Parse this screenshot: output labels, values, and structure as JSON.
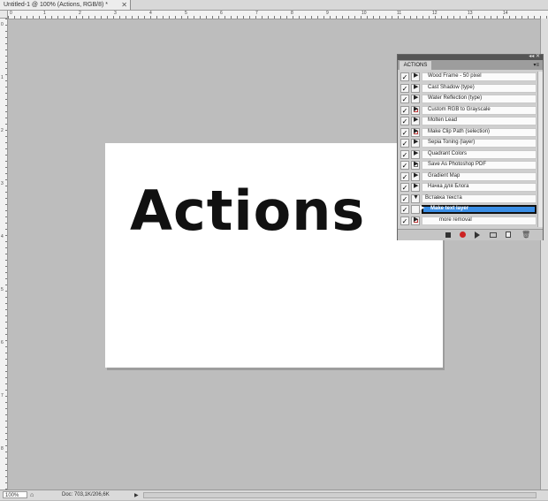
{
  "document": {
    "tab_title": "Untitled-1 @ 100% (Actions, RGB/8)",
    "tab_modified": "*",
    "canvas_text": "Actions"
  },
  "rulers": {
    "top": [
      "0",
      "1",
      "2",
      "3",
      "4",
      "5",
      "6",
      "7",
      "8",
      "9",
      "10",
      "11",
      "12",
      "13",
      "14"
    ],
    "left": [
      "0",
      "1",
      "2",
      "3",
      "4",
      "5",
      "6",
      "7",
      "8"
    ]
  },
  "statusbar": {
    "zoom": "100%",
    "doc_size": "Doc: 703,1K/206,6K"
  },
  "actions_panel": {
    "tab_label": "ACTIONS",
    "menu_icon": "panel-menu-icon",
    "items": [
      {
        "label": "Wood Frame - 50 pixel",
        "checked": true,
        "dialog": false,
        "expanded": false
      },
      {
        "label": "Cast Shadow (type)",
        "checked": true,
        "dialog": false,
        "expanded": false
      },
      {
        "label": "Water Reflection (type)",
        "checked": true,
        "dialog": false,
        "expanded": false
      },
      {
        "label": "Custom RGB to Grayscale",
        "checked": true,
        "dialog": true,
        "expanded": false
      },
      {
        "label": "Molten Lead",
        "checked": true,
        "dialog": false,
        "expanded": false
      },
      {
        "label": "Make Clip Path (selection)",
        "checked": true,
        "dialog": true,
        "expanded": false
      },
      {
        "label": "Sepia Toning (layer)",
        "checked": true,
        "dialog": false,
        "expanded": false
      },
      {
        "label": "Quadrant Colors",
        "checked": true,
        "dialog": false,
        "expanded": false
      },
      {
        "label": "Save As Photoshop PDF",
        "checked": true,
        "dialog": true,
        "expanded": false
      },
      {
        "label": "Gradient Map",
        "checked": true,
        "dialog": false,
        "expanded": false
      },
      {
        "label": "Начка для Блога",
        "checked": true,
        "dialog": false,
        "expanded": false
      },
      {
        "label": "Вставка текста",
        "checked": true,
        "dialog": false,
        "expanded": true
      },
      {
        "label": "Make text layer",
        "checked": true,
        "dialog": false,
        "expanded": false,
        "selected": true
      },
      {
        "label": "more removal",
        "checked": true,
        "dialog": true,
        "expanded": false
      }
    ],
    "bottom_icons": [
      "stop-icon",
      "record-icon",
      "play-icon",
      "new-set-icon",
      "new-action-icon",
      "delete-icon"
    ]
  }
}
